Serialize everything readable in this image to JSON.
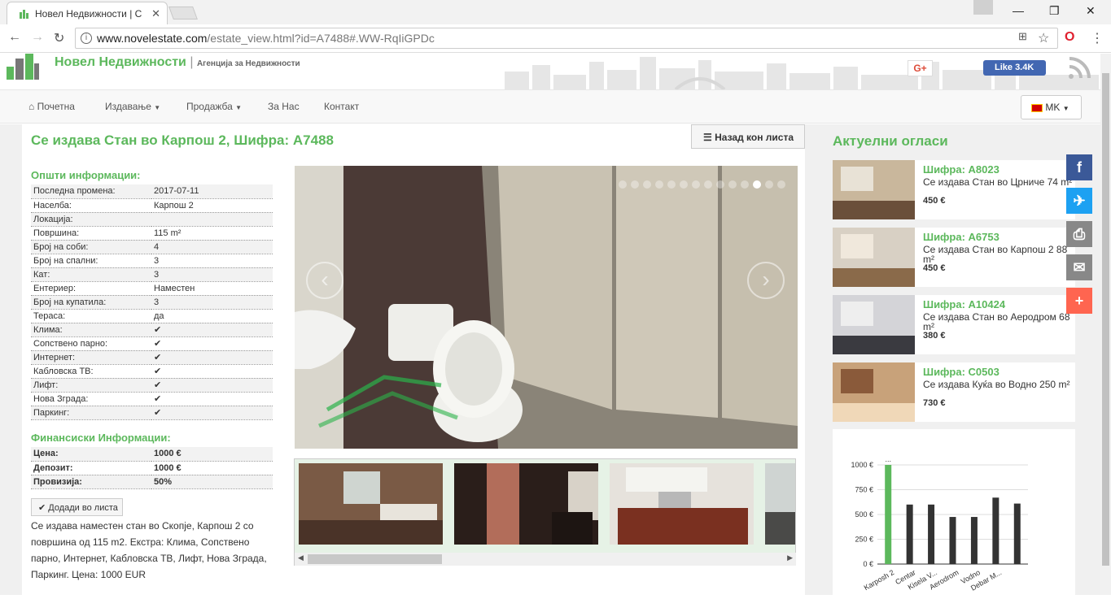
{
  "browser": {
    "tab_title": "Новел Недвижности | С",
    "url_domain": "www.novelestate.com",
    "url_path": "/estate_view.html?id=A7488#.WW-RqIiGPDc"
  },
  "header": {
    "brand": "Новел Недвижности",
    "tagline": "Агенција за Недвижности",
    "gplus": "G+",
    "fb_like": "Like 3.4K"
  },
  "nav": {
    "home": "Почетна",
    "rent": "Издавање",
    "sale": "Продажба",
    "about": "За Нас",
    "contact": "Контакт",
    "lang": "MK"
  },
  "listing": {
    "title": "Се издава Стан во Карпош 2, Шифра: A7488",
    "back_button": "Назад кон листа",
    "general_heading": "Општи информации:",
    "general": [
      {
        "k": "Последна промена:",
        "v": "2017-07-11"
      },
      {
        "k": "Населба:",
        "v": "Карпош 2"
      },
      {
        "k": "Локација:",
        "v": ""
      },
      {
        "k": "Површина:",
        "v": "115 m²"
      },
      {
        "k": "Број на соби:",
        "v": "4"
      },
      {
        "k": "Број на спални:",
        "v": "3"
      },
      {
        "k": "Кат:",
        "v": "3"
      },
      {
        "k": "Ентериер:",
        "v": "Наместен"
      },
      {
        "k": "Број на купатила:",
        "v": "3"
      },
      {
        "k": "Тераса:",
        "v": "да"
      },
      {
        "k": "Клима:",
        "v": "✔"
      },
      {
        "k": "Сопствено парно:",
        "v": "✔"
      },
      {
        "k": "Интернет:",
        "v": "✔"
      },
      {
        "k": "Кабловска ТВ:",
        "v": "✔"
      },
      {
        "k": "Лифт:",
        "v": "✔"
      },
      {
        "k": "Нова Зграда:",
        "v": "✔"
      },
      {
        "k": "Паркинг:",
        "v": "✔"
      }
    ],
    "financial_heading": "Финансиски Информации:",
    "financial": [
      {
        "k": "Цена:",
        "v": "1000 €"
      },
      {
        "k": "Депозит:",
        "v": "1000 €"
      },
      {
        "k": "Провизија:",
        "v": "50%"
      }
    ],
    "add_button": "Додади во листа",
    "description": "Се издава наместен стан во Скопје, Карпош 2 со површина од 115 m2. Екстра: Клима, Сопствено парно, Интернет, Кабловска ТВ, Лифт, Нова Зграда, Паркинг. Цена: 1000 EUR",
    "carousel": {
      "slides": 14,
      "active": 11,
      "prev": "‹",
      "next": "›"
    }
  },
  "sidebar": {
    "title": "Актуелни огласи",
    "cards": [
      {
        "code": "Шифра: A8023",
        "title": "Се издава Стан во Црниче 74 m²",
        "price": "450 €"
      },
      {
        "code": "Шифра: A6753",
        "title": "Се издава Стан во Карпош 2 88 m²",
        "price": "450 €"
      },
      {
        "code": "Шифра: A10424",
        "title": "Се издава Стан во Аеродром 68 m²",
        "price": "380 €"
      },
      {
        "code": "Шифра: C0503",
        "title": "Се издава Куќа во Водно 250 m²",
        "price": "730 €"
      }
    ]
  },
  "chart_data": {
    "type": "bar",
    "categories": [
      "Karposh 2",
      "Centar",
      "Kisela V...",
      "Aerodrom",
      "Vodno",
      "Debar M..."
    ],
    "values": [
      1000,
      600,
      600,
      475,
      475,
      670,
      610
    ],
    "bars": [
      1000,
      600,
      600,
      475,
      475,
      670,
      610
    ],
    "bar_colors": [
      "#5cb85c",
      "#333333",
      "#333333",
      "#333333",
      "#333333",
      "#333333",
      "#333333"
    ],
    "yticks": [
      "0 €",
      "250 €",
      "500 €",
      "750 €",
      "1000 €"
    ],
    "ylim": [
      0,
      1000
    ],
    "top_label": "..."
  },
  "colors": {
    "accent": "#5cb85c"
  }
}
